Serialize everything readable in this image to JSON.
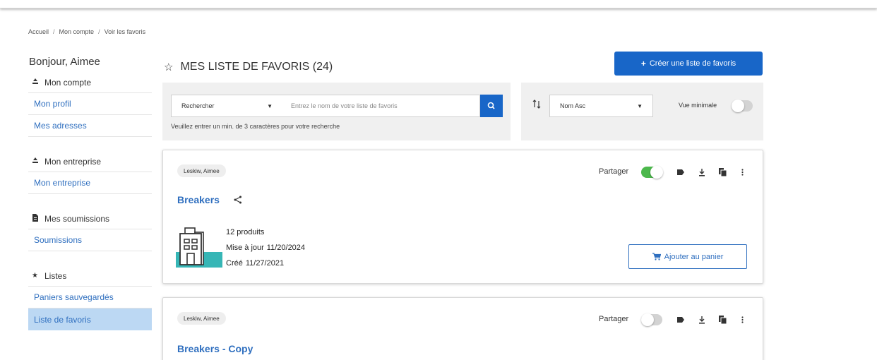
{
  "breadcrumb": [
    "Accueil",
    "Mon compte",
    "Voir les favoris"
  ],
  "sidebar": {
    "greeting": "Bonjour, Aimee",
    "sections": [
      {
        "title": "Mon compte",
        "icon": "user-icon",
        "links": [
          "Mon profil",
          "Mes adresses"
        ]
      },
      {
        "title": "Mon entreprise",
        "icon": "user-icon",
        "links": [
          "Mon entreprise"
        ]
      },
      {
        "title": "Mes soumissions",
        "icon": "document-icon",
        "links": [
          "Soumissions"
        ]
      },
      {
        "title": "Listes",
        "icon": "star-icon",
        "links": [
          "Paniers sauvegardés",
          "Liste de favoris"
        ]
      }
    ],
    "active_link": "Liste de favoris"
  },
  "main": {
    "title": "MES LISTE DE FAVORIS (24)",
    "create_button": "Créer une liste de favoris",
    "search": {
      "scope_value": "Rechercher",
      "placeholder": "Entrez le nom de votre liste de favoris",
      "hint": "Veuillez entrer un min. de 3 caractères pour votre recherche"
    },
    "sort": {
      "value": "Nom Asc",
      "view_label": "Vue minimale",
      "view_enabled": false
    },
    "lists": [
      {
        "owner": "Leskiw, Aimee",
        "share_label": "Partager",
        "shared": true,
        "name": "Breakers",
        "products": "12 produits",
        "updated_label": "Mise à jour",
        "updated": "11/20/2024",
        "created_label": "Créé",
        "created": "11/27/2021",
        "cart_button": "Ajouter au panier"
      },
      {
        "owner": "Leskiw, Aimee",
        "share_label": "Partager",
        "shared": false,
        "name": "Breakers - Copy"
      }
    ]
  },
  "colors": {
    "primary": "#1866c8",
    "link": "#2f6fbf",
    "active_bg": "#bcd8f3",
    "toggle_on": "#4cb84c",
    "thumb_accent": "#36b6b6"
  }
}
